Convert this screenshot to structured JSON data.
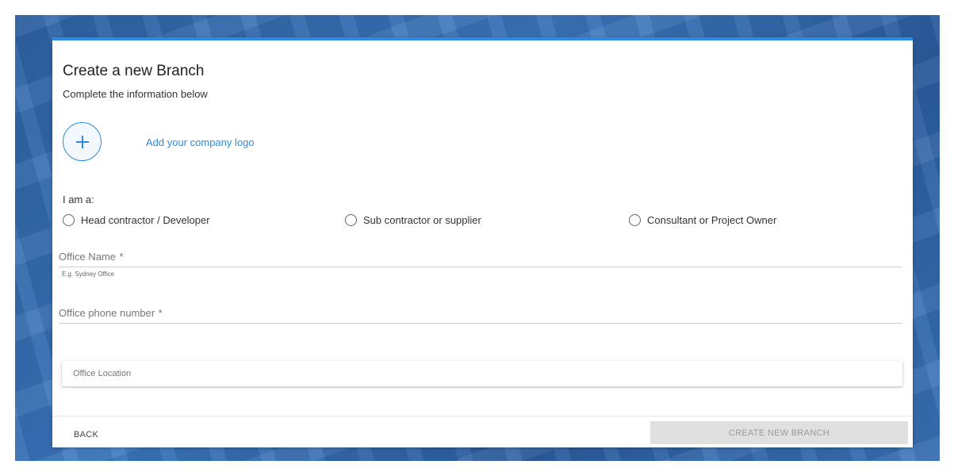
{
  "form": {
    "title": "Create a new Branch",
    "subtitle": "Complete the information below",
    "logo": {
      "icon": "plus-icon",
      "link_label": "Add your company logo"
    },
    "role": {
      "label": "I am a:",
      "options": [
        {
          "label": "Head contractor / Developer",
          "selected": false
        },
        {
          "label": "Sub contractor or supplier",
          "selected": false
        },
        {
          "label": "Consultant or Project Owner",
          "selected": false
        }
      ]
    },
    "office_name": {
      "label": "Office Name",
      "required_mark": "*",
      "value": "",
      "hint": "E.g. Sydney Office"
    },
    "office_phone": {
      "label": "Office phone number",
      "required_mark": "*",
      "value": ""
    },
    "office_location": {
      "placeholder": "Office Location",
      "value": ""
    }
  },
  "footer": {
    "back_label": "BACK",
    "create_label": "CREATE NEW BRANCH",
    "create_disabled": true
  },
  "colors": {
    "accent": "#2b8be3",
    "disabled_bg": "#e0e0e0",
    "disabled_text": "#9a9a9a"
  }
}
